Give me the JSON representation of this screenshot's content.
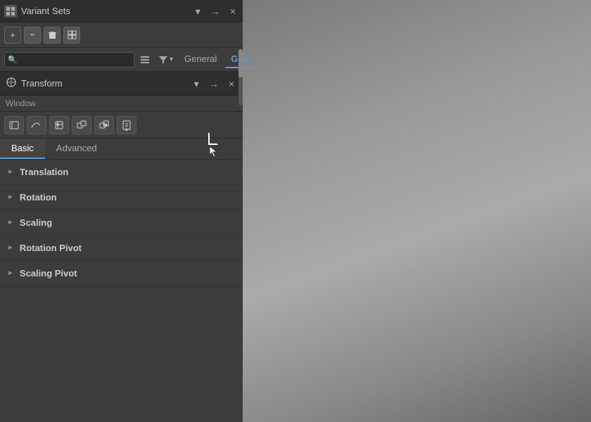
{
  "variantSets": {
    "title": "Variant Sets",
    "close_btn": "×",
    "pin_btn": "→",
    "down_btn": "▾",
    "tabs": [
      {
        "label": "General",
        "active": false
      },
      {
        "label": "Geo",
        "active": true
      }
    ],
    "toolbar": {
      "add_label": "+",
      "more_label": "••",
      "delete_label": "🗑",
      "grid_label": "▦"
    },
    "search": {
      "placeholder": "",
      "filter_label": "▾"
    }
  },
  "transform": {
    "title": "Transform",
    "close_label": "×",
    "window_label": "Window",
    "tabs": [
      {
        "label": "Basic",
        "active": true
      },
      {
        "label": "Advanced",
        "active": false
      }
    ],
    "properties": [
      {
        "label": "Translation"
      },
      {
        "label": "Rotation"
      },
      {
        "label": "Scaling"
      },
      {
        "label": "Rotation Pivot"
      },
      {
        "label": "Scaling Pivot"
      }
    ],
    "toolbar_buttons": [
      "↺",
      "↩",
      "✦",
      "⬛",
      "⬛",
      "⬛"
    ]
  }
}
